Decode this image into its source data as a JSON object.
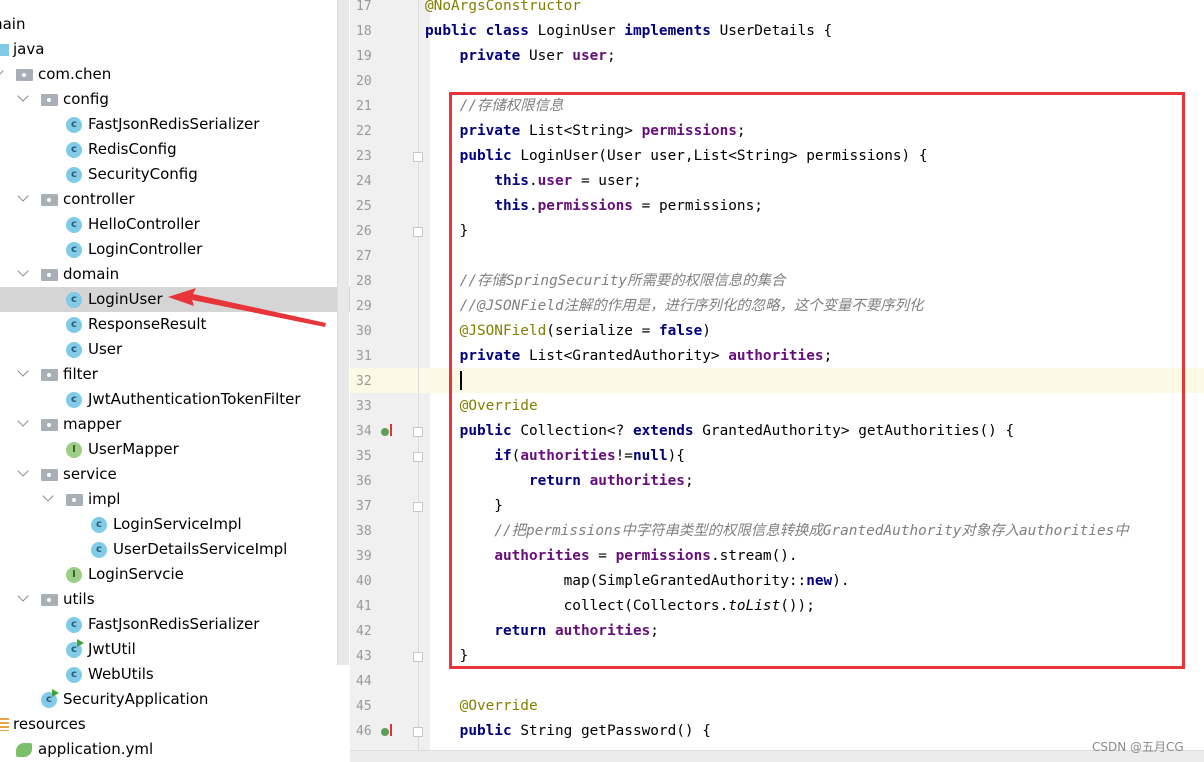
{
  "tree": [
    {
      "label": "main",
      "level": 0,
      "type": "none"
    },
    {
      "label": "java",
      "level": 1,
      "type": "src"
    },
    {
      "label": "com.chen",
      "level": 2,
      "type": "folder",
      "expanded": true
    },
    {
      "label": "config",
      "level": 3,
      "type": "folder",
      "expanded": true
    },
    {
      "label": "FastJsonRedisSerializer",
      "level": 4,
      "type": "class"
    },
    {
      "label": "RedisConfig",
      "level": 4,
      "type": "class"
    },
    {
      "label": "SecurityConfig",
      "level": 4,
      "type": "class"
    },
    {
      "label": "controller",
      "level": 3,
      "type": "folder",
      "expanded": true
    },
    {
      "label": "HelloController",
      "level": 4,
      "type": "class"
    },
    {
      "label": "LoginController",
      "level": 4,
      "type": "class"
    },
    {
      "label": "domain",
      "level": 3,
      "type": "folder",
      "expanded": true
    },
    {
      "label": "LoginUser",
      "level": 4,
      "type": "class",
      "selected": true
    },
    {
      "label": "ResponseResult",
      "level": 4,
      "type": "class"
    },
    {
      "label": "User",
      "level": 4,
      "type": "class"
    },
    {
      "label": "filter",
      "level": 3,
      "type": "folder",
      "expanded": true
    },
    {
      "label": "JwtAuthenticationTokenFilter",
      "level": 4,
      "type": "class"
    },
    {
      "label": "mapper",
      "level": 3,
      "type": "folder",
      "expanded": true
    },
    {
      "label": "UserMapper",
      "level": 4,
      "type": "interface"
    },
    {
      "label": "service",
      "level": 3,
      "type": "folder",
      "expanded": true
    },
    {
      "label": "impl",
      "level": 4,
      "type": "folder",
      "expanded": true
    },
    {
      "label": "LoginServiceImpl",
      "level": 5,
      "type": "class"
    },
    {
      "label": "UserDetailsServiceImpl",
      "level": 5,
      "type": "class"
    },
    {
      "label": "LoginServcie",
      "level": 4,
      "type": "interface"
    },
    {
      "label": "utils",
      "level": 3,
      "type": "folder",
      "expanded": true
    },
    {
      "label": "FastJsonRedisSerializer",
      "level": 4,
      "type": "class"
    },
    {
      "label": "JwtUtil",
      "level": 4,
      "type": "runclass"
    },
    {
      "label": "WebUtils",
      "level": 4,
      "type": "class"
    },
    {
      "label": "SecurityApplication",
      "level": 3,
      "type": "appclass"
    },
    {
      "label": "resources",
      "level": 1,
      "type": "res"
    },
    {
      "label": "application.yml",
      "level": 2,
      "type": "yml"
    }
  ],
  "editor": {
    "current_line": 32,
    "lines": [
      {
        "n": 17,
        "t": [
          [
            "an",
            "@NoArgsConstructor"
          ]
        ]
      },
      {
        "n": 18,
        "t": [
          [
            "kw",
            "public class "
          ],
          [
            "",
            "LoginUser "
          ],
          [
            "kw",
            "implements "
          ],
          [
            "",
            "UserDetails {"
          ]
        ]
      },
      {
        "n": 19,
        "t": [
          [
            "",
            "    "
          ],
          [
            "kw",
            "private "
          ],
          [
            "",
            "User "
          ],
          [
            "fd",
            "user"
          ],
          [
            "",
            ";"
          ]
        ]
      },
      {
        "n": 20,
        "t": []
      },
      {
        "n": 21,
        "t": [
          [
            "",
            "    "
          ],
          [
            "cm",
            "//存储权限信息"
          ]
        ]
      },
      {
        "n": 22,
        "t": [
          [
            "",
            "    "
          ],
          [
            "kw",
            "private "
          ],
          [
            "",
            "List<String> "
          ],
          [
            "fd",
            "permissions"
          ],
          [
            "",
            ";"
          ]
        ]
      },
      {
        "n": 23,
        "t": [
          [
            "",
            "    "
          ],
          [
            "kw",
            "public "
          ],
          [
            "",
            "LoginUser(User user,List<String> permissions) {"
          ]
        ],
        "fold": true
      },
      {
        "n": 24,
        "t": [
          [
            "",
            "        "
          ],
          [
            "kw",
            "this"
          ],
          [
            "",
            "."
          ],
          [
            "fd",
            "user"
          ],
          [
            "",
            " = user;"
          ]
        ]
      },
      {
        "n": 25,
        "t": [
          [
            "",
            "        "
          ],
          [
            "kw",
            "this"
          ],
          [
            "",
            "."
          ],
          [
            "fd",
            "permissions"
          ],
          [
            "",
            " = permissions;"
          ]
        ]
      },
      {
        "n": 26,
        "t": [
          [
            "",
            "    }"
          ]
        ],
        "fold": true
      },
      {
        "n": 27,
        "t": []
      },
      {
        "n": 28,
        "t": [
          [
            "",
            "    "
          ],
          [
            "cm",
            "//存储SpringSecurity所需要的权限信息的集合"
          ]
        ]
      },
      {
        "n": 29,
        "t": [
          [
            "",
            "    "
          ],
          [
            "cm",
            "//@JSONField注解的作用是，进行序列化的忽略，这个变量不要序列化"
          ]
        ]
      },
      {
        "n": 30,
        "t": [
          [
            "",
            "    "
          ],
          [
            "an",
            "@JSONField"
          ],
          [
            "",
            "(serialize = "
          ],
          [
            "kw",
            "false"
          ],
          [
            "",
            ")"
          ]
        ]
      },
      {
        "n": 31,
        "t": [
          [
            "",
            "    "
          ],
          [
            "kw",
            "private "
          ],
          [
            "",
            "List<GrantedAuthority> "
          ],
          [
            "fd",
            "authorities"
          ],
          [
            "",
            ";"
          ]
        ]
      },
      {
        "n": 32,
        "t": []
      },
      {
        "n": 33,
        "t": [
          [
            "",
            "    "
          ],
          [
            "an",
            "@Override"
          ]
        ]
      },
      {
        "n": 34,
        "t": [
          [
            "",
            "    "
          ],
          [
            "kw",
            "public "
          ],
          [
            "",
            "Collection<? "
          ],
          [
            "kw",
            "extends "
          ],
          [
            "",
            "GrantedAuthority> getAuthorities() {"
          ]
        ],
        "fold": true,
        "override": true
      },
      {
        "n": 35,
        "t": [
          [
            "",
            "        "
          ],
          [
            "kw",
            "if"
          ],
          [
            "",
            "("
          ],
          [
            "fd",
            "authorities"
          ],
          [
            "",
            "!="
          ],
          [
            "kw",
            "null"
          ],
          [
            "",
            "){"
          ]
        ],
        "fold": true
      },
      {
        "n": 36,
        "t": [
          [
            "",
            "            "
          ],
          [
            "kw",
            "return "
          ],
          [
            "fd",
            "authorities"
          ],
          [
            "",
            ";"
          ]
        ]
      },
      {
        "n": 37,
        "t": [
          [
            "",
            "        }"
          ]
        ],
        "fold": true
      },
      {
        "n": 38,
        "t": [
          [
            "",
            "        "
          ],
          [
            "cm",
            "//把permissions中字符串类型的权限信息转换成GrantedAuthority对象存入authorities中"
          ]
        ]
      },
      {
        "n": 39,
        "t": [
          [
            "",
            "        "
          ],
          [
            "fd",
            "authorities"
          ],
          [
            "",
            " = "
          ],
          [
            "fd",
            "permissions"
          ],
          [
            "",
            ".stream()."
          ]
        ]
      },
      {
        "n": 40,
        "t": [
          [
            "",
            "                map(SimpleGrantedAuthority::"
          ],
          [
            "kw",
            "new"
          ],
          [
            "",
            ")."
          ]
        ]
      },
      {
        "n": 41,
        "t": [
          [
            "",
            "                collect(Collectors."
          ],
          [
            "st",
            "toList"
          ],
          [
            "",
            "());"
          ]
        ]
      },
      {
        "n": 42,
        "t": [
          [
            "",
            "        "
          ],
          [
            "kw",
            "return "
          ],
          [
            "fd",
            "authorities"
          ],
          [
            "",
            ";"
          ]
        ]
      },
      {
        "n": 43,
        "t": [
          [
            "",
            "    }"
          ]
        ],
        "fold": true
      },
      {
        "n": 44,
        "t": []
      },
      {
        "n": 45,
        "t": [
          [
            "",
            "    "
          ],
          [
            "an",
            "@Override"
          ]
        ]
      },
      {
        "n": 46,
        "t": [
          [
            "",
            "    "
          ],
          [
            "kw",
            "public "
          ],
          [
            "",
            "String getPassword() {"
          ]
        ],
        "fold": true,
        "override": true
      }
    ]
  },
  "colors": {
    "highlight_box": "#e8353a",
    "annotation_arrow": "#e8353a",
    "selection": "#d5d5d5"
  },
  "watermark": "CSDN @五月CG"
}
